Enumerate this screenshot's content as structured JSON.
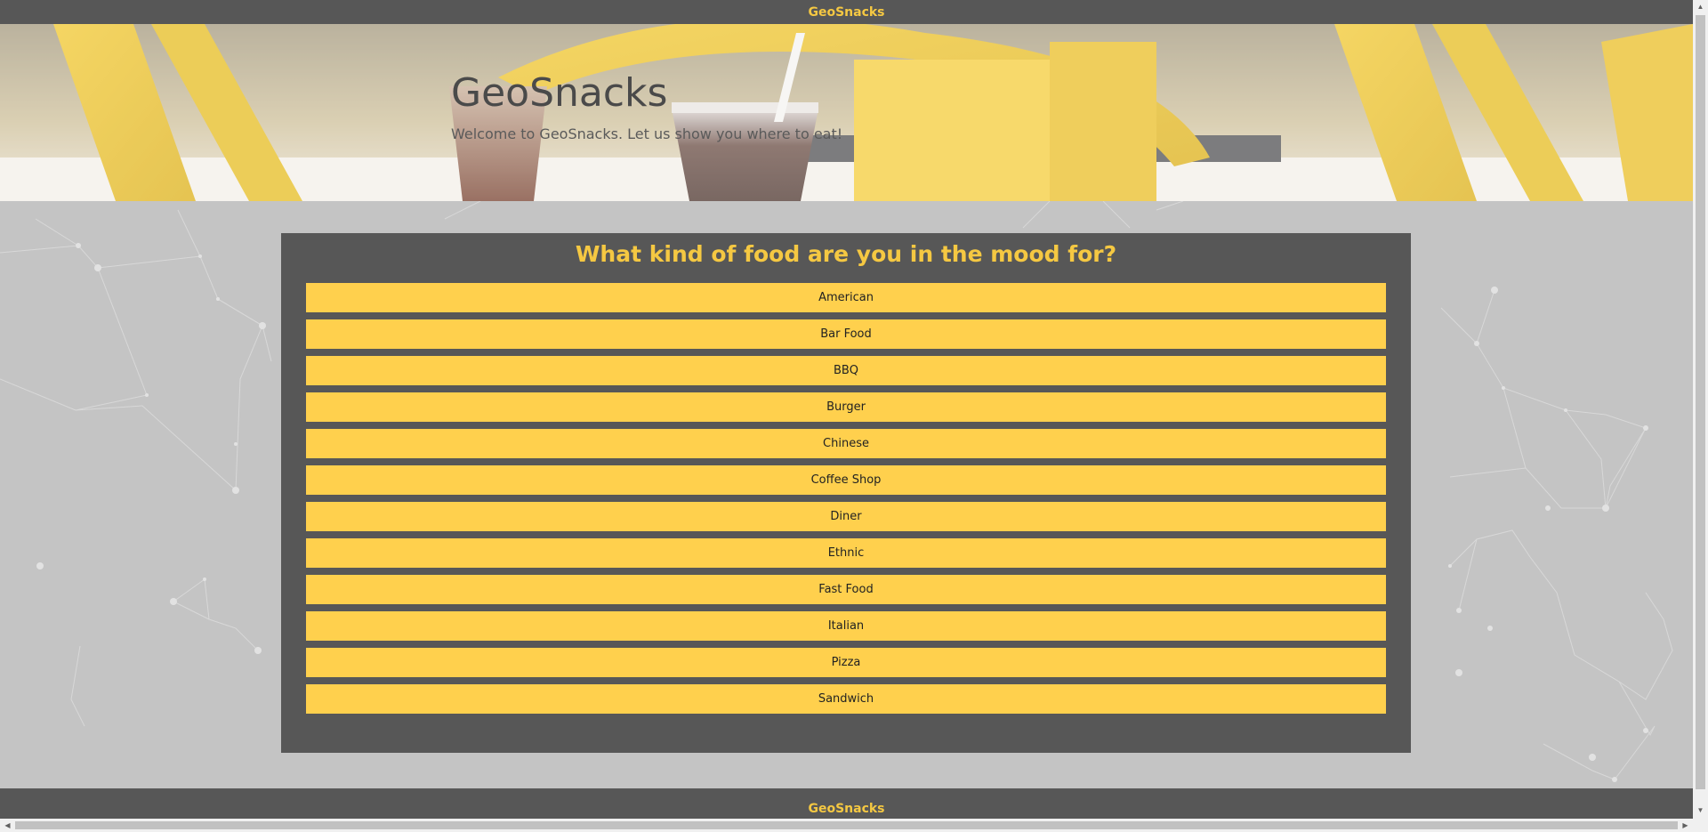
{
  "nav": {
    "brand": "GeoSnacks"
  },
  "hero": {
    "title": "GeoSnacks",
    "subtitle": "Welcome to GeoSnacks. Let us show you where to eat!"
  },
  "panel": {
    "title": "What kind of food are you in the mood for?",
    "options": [
      "American",
      "Bar Food",
      "BBQ",
      "Burger",
      "Chinese",
      "Coffee Shop",
      "Diner",
      "Ethnic",
      "Fast Food",
      "Italian",
      "Pizza",
      "Sandwich"
    ]
  },
  "footer": {
    "brand": "GeoSnacks"
  },
  "colors": {
    "bar": "#575757",
    "accent": "#f5c842",
    "button": "#ffd04d",
    "background": "#c4c4c4"
  },
  "icons": {
    "scroll_up": "chevron-up-icon",
    "scroll_down": "chevron-down-icon",
    "scroll_left": "chevron-left-icon",
    "scroll_right": "chevron-right-icon"
  }
}
